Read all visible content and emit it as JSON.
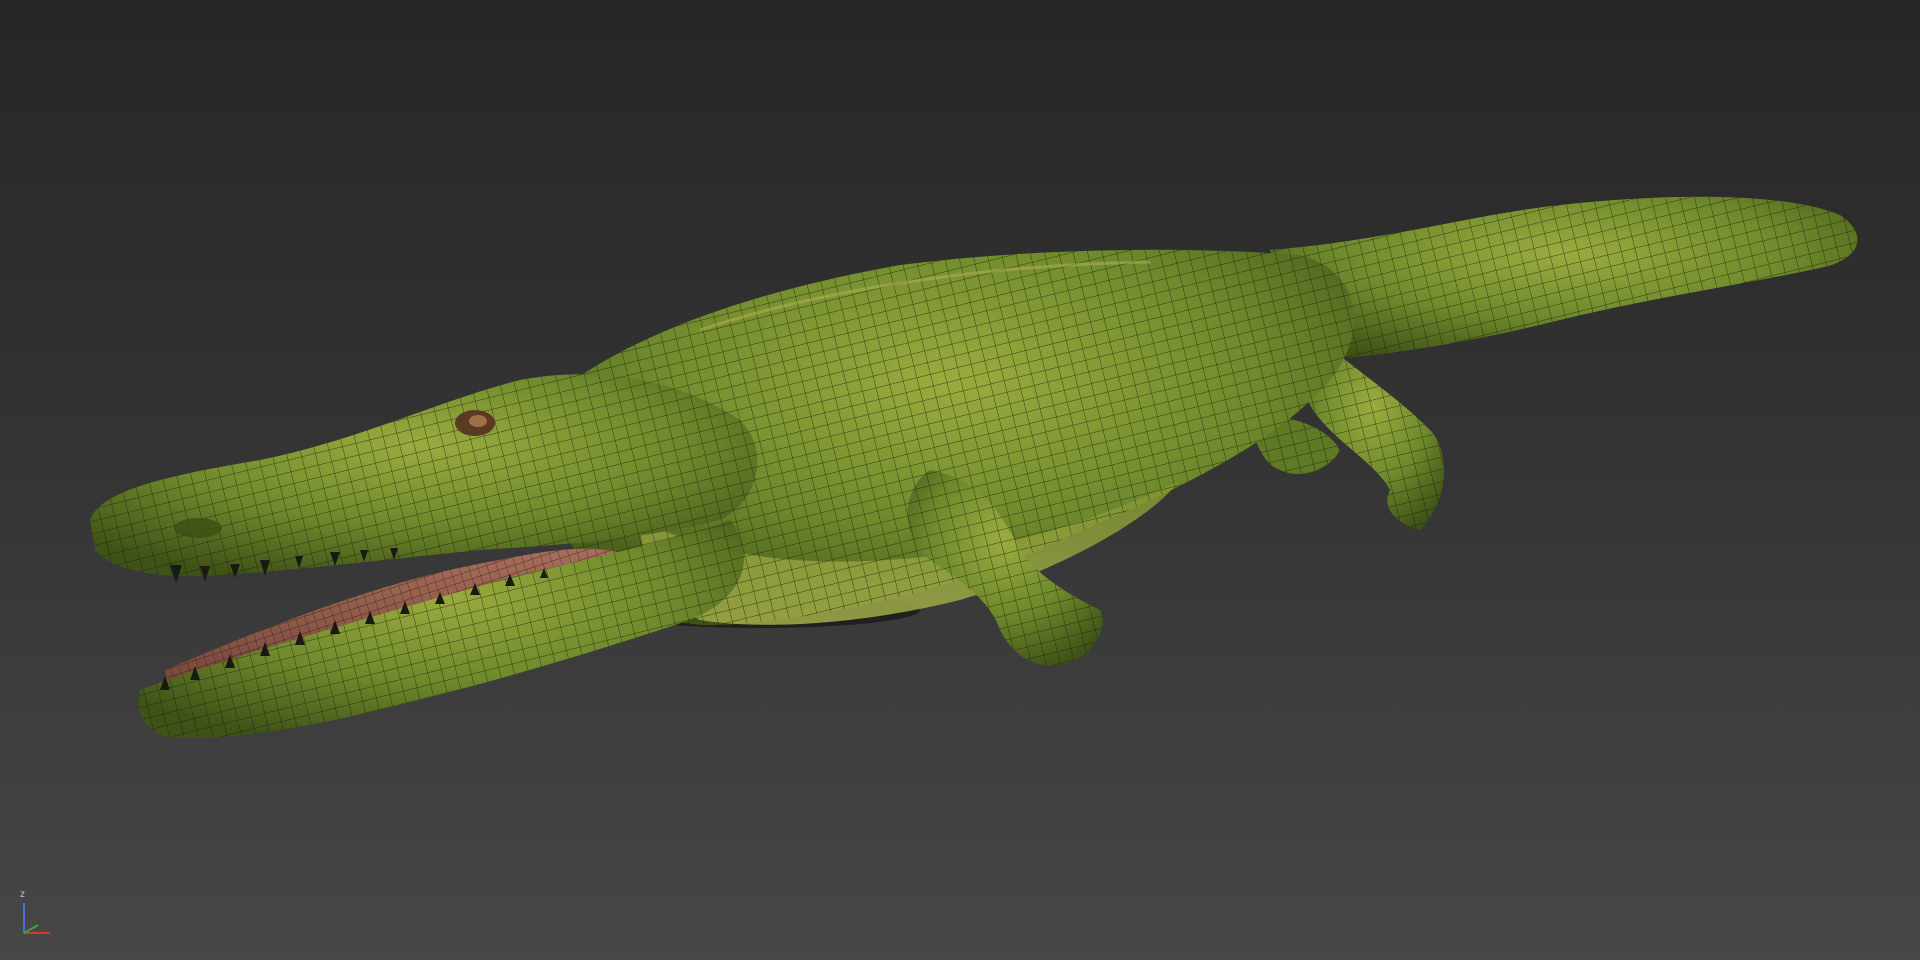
{
  "viewport": {
    "shading_mode": "wireframe-on-shaded",
    "background_top": "#262626",
    "background_bottom": "#474747"
  },
  "model": {
    "subject": "crocodile",
    "skin_color": "#6f8a2c",
    "skin_highlight": "#9aac3e",
    "skin_shadow": "#3f5217",
    "mouth_color": "#8c5a4a",
    "wire_color": "#1b1f0c",
    "mouth_state": "open"
  },
  "axis_gizmo": {
    "z_label": "z",
    "x_color": "#d23a2a",
    "y_color": "#3aa83a",
    "z_color": "#4a6adf"
  }
}
